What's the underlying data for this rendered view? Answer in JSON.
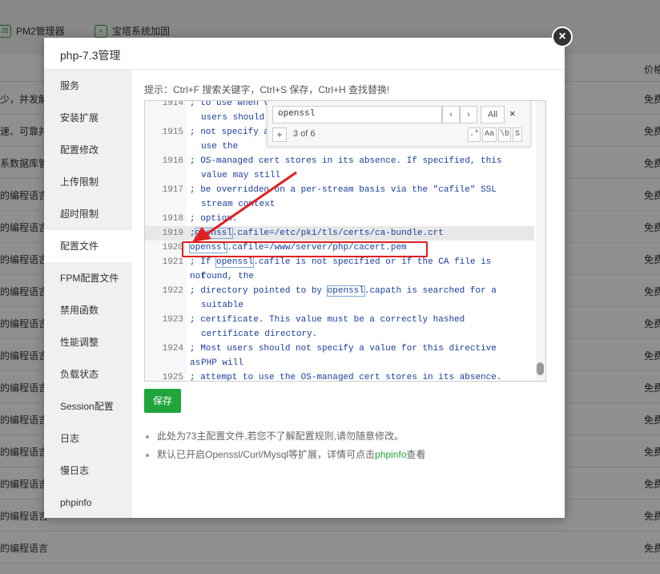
{
  "background": {
    "tabs": [
      {
        "label": "PM2管理器",
        "icon": "nodejs-icon"
      },
      {
        "label": "宝塔系统加固",
        "icon": "shield-icon"
      }
    ],
    "header_price": "价格",
    "rows": [
      {
        "desc": "少，并发解",
        "price": "免费"
      },
      {
        "desc": "速、可靠并",
        "price": "免费"
      },
      {
        "desc": "系数据库管",
        "price": "免费"
      },
      {
        "desc": "的编程语言",
        "price": "免费"
      },
      {
        "desc": "的编程语言",
        "price": "免费"
      },
      {
        "desc": "的编程语言",
        "price": "免费"
      },
      {
        "desc": "的编程语言",
        "price": "免费"
      },
      {
        "desc": "的编程语言",
        "price": "免费"
      },
      {
        "desc": "的编程语言",
        "price": "免费"
      },
      {
        "desc": "的编程语言",
        "price": "免费"
      },
      {
        "desc": "的编程语言",
        "price": "免费"
      },
      {
        "desc": "的编程语言",
        "price": "免费"
      },
      {
        "desc": "的编程语言",
        "price": "免费"
      },
      {
        "desc": "的编程语言",
        "price": "免费"
      },
      {
        "desc": "的编程语言",
        "price": "免费"
      }
    ]
  },
  "modal": {
    "title": "php-7.3管理",
    "close_label": "×",
    "sidebar": [
      "服务",
      "安装扩展",
      "配置修改",
      "上传限制",
      "超时限制",
      "配置文件",
      "FPM配置文件",
      "禁用函数",
      "性能调整",
      "负载状态",
      "Session配置",
      "日志",
      "慢日志",
      "phpinfo"
    ],
    "active_index": 5,
    "tip": "提示：Ctrl+F 搜索关键字，Ctrl+S 保存，Ctrl+H 查找替换!",
    "save_label": "保存",
    "notes": [
      {
        "text": "此处为73主配置文件,若您不了解配置规则,请勿随意修改。"
      },
      {
        "text": "默认已开启Openssl/Curl/Mysql等扩展，详情可点击",
        "link": "phpinfo",
        "after": "查看"
      }
    ]
  },
  "editor": {
    "search": {
      "query": "openssl",
      "count": "3 of 6",
      "prev": "‹",
      "next": "›",
      "all": "All",
      "close": "×",
      "plus": "+",
      "regex": ".*",
      "case": "Aa",
      "word": "\\b",
      "sel": "S"
    },
    "lines": [
      {
        "num": "1914",
        "a": "; to use when v",
        "b": "users should"
      },
      {
        "num": "1915",
        "a": "; not specify a",
        "b": "use the"
      },
      {
        "num": "1916",
        "a": "; OS-managed cert stores in its absence. If specified, this",
        "b": "value may still"
      },
      {
        "num": "1917",
        "a": "; be overridden on a per-stream basis via the \"cafile\" SSL",
        "b": "stream context"
      },
      {
        "num": "1918",
        "a": "; option.",
        "b": ""
      },
      {
        "num": "1919",
        "pre": ";",
        "kw": "openssl",
        "post": ".cafile=/etc/pki/tls/certs/ca-bundle.crt"
      },
      {
        "num": "1920",
        "pre": "",
        "kw": "openssl",
        "post": ".cafile=/www/server/php/cacert.pem"
      },
      {
        "num": "1921",
        "pre": "; If ",
        "kw": "openssl",
        "post": ".cafile is not specified or if the CA file is not",
        "b": "found, the"
      },
      {
        "num": "1922",
        "pre": "; directory pointed to by ",
        "kw": "openssl",
        "post": ".capath is searched for a",
        "b": "suitable"
      },
      {
        "num": "1923",
        "a": "; certificate. This value must be a correctly hashed",
        "b": "certificate directory."
      },
      {
        "num": "1924",
        "a": "; Most users should not specify a value for this directive as",
        "b": "PHP will"
      },
      {
        "num": "1925",
        "a": "; attempt to use the OS-managed cert stores in its absence. If",
        "b": ""
      }
    ]
  },
  "colors": {
    "accent": "#20a53a",
    "annotation": "#e02020",
    "code": "#1a3e9e"
  }
}
